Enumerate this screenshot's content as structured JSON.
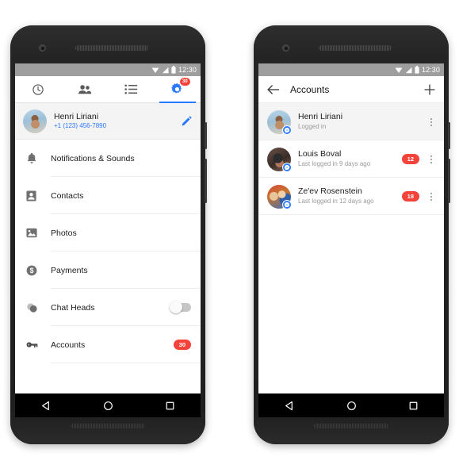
{
  "status_bar": {
    "time": "12:30",
    "icons": [
      "wifi-icon",
      "signal-icon",
      "battery-icon"
    ]
  },
  "colors": {
    "accent_blue": "#2979ff",
    "badge_red": "#f4433a",
    "status_gray": "#9e9e9e",
    "row_highlight": "#f4f4f4"
  },
  "left_phone": {
    "tabs": [
      {
        "name": "recents",
        "icon": "clock-icon",
        "active": "false",
        "badge": ""
      },
      {
        "name": "people",
        "icon": "people-icon",
        "active": "false",
        "badge": ""
      },
      {
        "name": "threads",
        "icon": "list-icon",
        "active": "false",
        "badge": ""
      },
      {
        "name": "settings",
        "icon": "gear-icon",
        "active": "true",
        "badge": "30"
      }
    ],
    "profile": {
      "name": "Henri Liriani",
      "phone": "+1 (123) 456-7890",
      "edit_icon": "pencil-icon"
    },
    "settings_items": [
      {
        "icon": "bell-icon",
        "label": "Notifications & Sounds",
        "control": "none",
        "badge": ""
      },
      {
        "icon": "contact-icon",
        "label": "Contacts",
        "control": "none",
        "badge": ""
      },
      {
        "icon": "photo-icon",
        "label": "Photos",
        "control": "none",
        "badge": ""
      },
      {
        "icon": "payments-icon",
        "label": "Payments",
        "control": "none",
        "badge": ""
      },
      {
        "icon": "chatheads-icon",
        "label": "Chat Heads",
        "control": "toggle",
        "badge": "",
        "toggle_on": "false"
      },
      {
        "icon": "key-icon",
        "label": "Accounts",
        "control": "badge",
        "badge": "30"
      }
    ]
  },
  "right_phone": {
    "appbar": {
      "back_icon": "arrow-back-icon",
      "title": "Accounts",
      "add_icon": "plus-icon"
    },
    "accounts": [
      {
        "name": "Henri Liriani",
        "status": "Logged in",
        "badge": "",
        "current": "true",
        "avatar": "henri"
      },
      {
        "name": "Louis Boval",
        "status": "Last logged in 9 days ago",
        "badge": "12",
        "current": "false",
        "avatar": "louis"
      },
      {
        "name": "Ze'ev Rosenstein",
        "status": "Last logged in 12 days ago",
        "badge": "18",
        "current": "false",
        "avatar": "zeev"
      }
    ]
  },
  "nav_bar": {
    "back": "back-triangle-icon",
    "home": "home-circle-icon",
    "recents": "recents-square-icon"
  }
}
